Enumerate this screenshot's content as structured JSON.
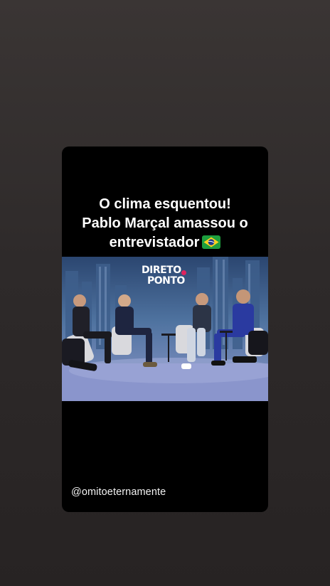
{
  "post": {
    "caption_line1": "O clima esquentou!",
    "caption_line2": "Pablo Marçal amassou o",
    "caption_line3": "entrevistador",
    "caption_emoji": "brazil-flag-icon",
    "video_logo_line1": "DIRETO",
    "video_logo_line2": "PONTO",
    "handle": "@omitoeternamente"
  },
  "colors": {
    "page_background": "#2e2a2a",
    "card_background": "#000000",
    "caption_text": "#ffffff",
    "logo_accent": "#e0245e"
  }
}
